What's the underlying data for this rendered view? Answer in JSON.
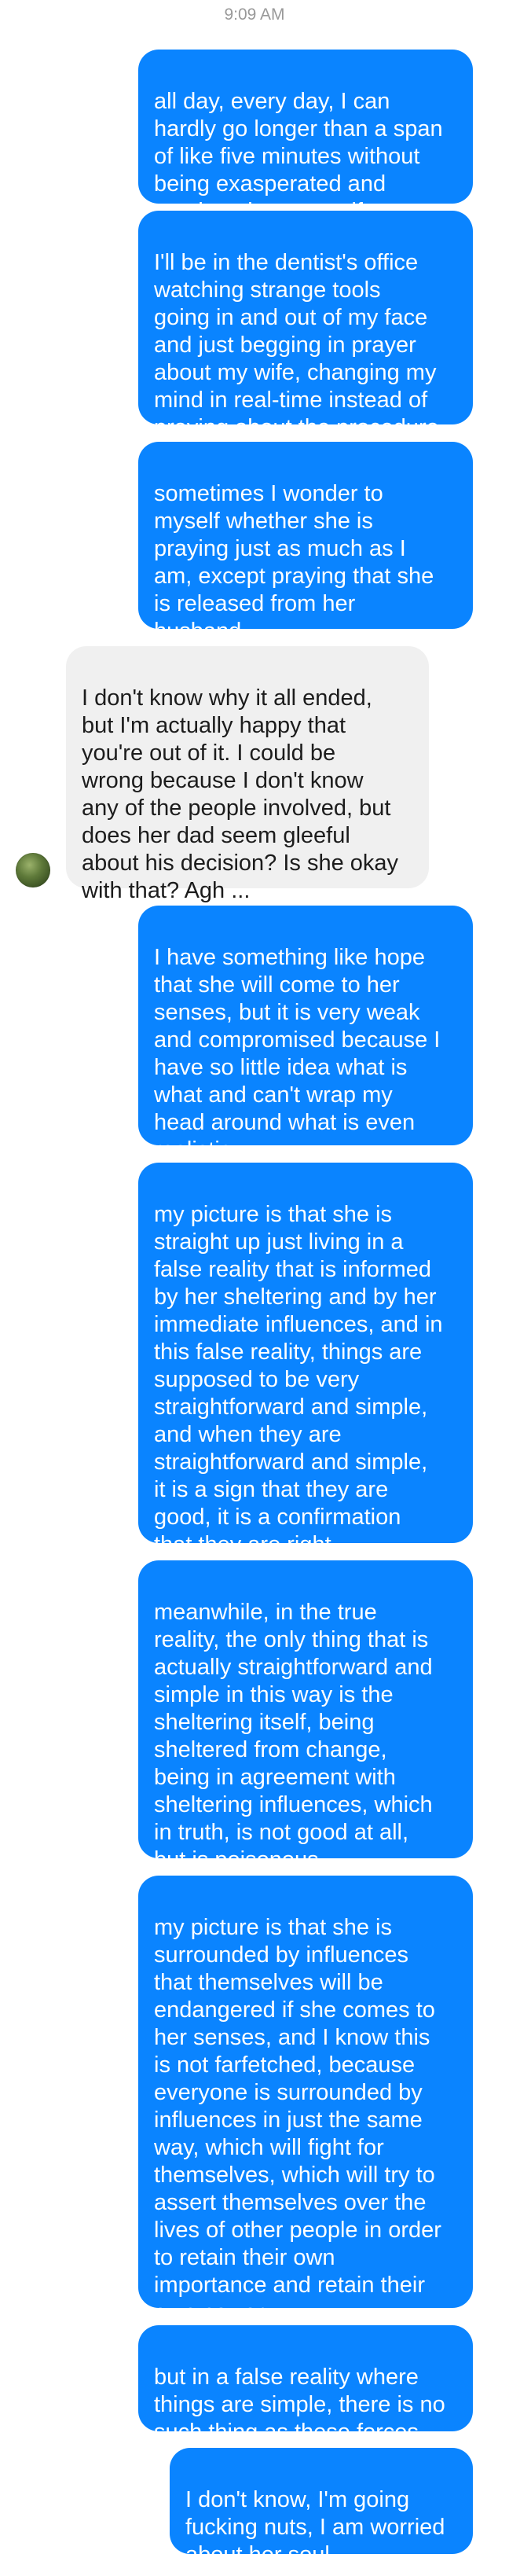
{
  "header": {
    "timestamp": "9:09 AM"
  },
  "contact": {
    "avatar_icon": "profile-photo-icon"
  },
  "messages": [
    {
      "sender": "me",
      "text": "all day, every day, I can\nhardly go longer than a span\nof like five minutes without\nbeing exasperated and\npraying about my wife"
    },
    {
      "sender": "me",
      "text": "I'll be in the dentist's office\nwatching strange tools\ngoing in and out of my face\nand just begging in prayer\nabout my wife, changing my\nmind in real-time instead of\npraying about the procedure"
    },
    {
      "sender": "me",
      "text": "sometimes I wonder to\nmyself whether she is\npraying just as much as I\nam, except praying that she\nis released from her\nhusband"
    },
    {
      "sender": "them",
      "text": "I don't know why it all ended,\nbut I'm actually happy that\nyou're out of it. I could be\nwrong because I don't know\nany of the people involved, but\ndoes her dad seem gleeful\nabout his decision? Is she okay\nwith that? Agh ..."
    },
    {
      "sender": "me",
      "text": "I have something like hope\nthat she will come to her\nsenses, but it is very weak\nand compromised because I\nhave so little idea what is\nwhat and can't wrap my\nhead around what is even\nrealistic"
    },
    {
      "sender": "me",
      "text": "my picture is that she is\nstraight up just living in a\nfalse reality that is informed\nby her sheltering and by her\nimmediate influences, and in\nthis false reality, things are\nsupposed to be very\nstraightforward and simple,\nand when they are\nstraightforward and simple,\nit is a sign that they are\ngood, it is a confirmation\nthat they are right"
    },
    {
      "sender": "me",
      "text": "meanwhile, in the true\nreality, the only thing that is\nactually straightforward and\nsimple in this way is the\nsheltering itself, being\nsheltered from change,\nbeing in agreement with\nsheltering influences, which\nin truth, is not good at all,\nbut is poisonous"
    },
    {
      "sender": "me",
      "text": "my picture is that she is\nsurrounded by influences\nthat themselves will be\nendangered if she comes to\nher senses, and I know this\nis not farfetched, because\neveryone is surrounded by\ninfluences in just the same\nway, which will fight for\nthemselves, which will try to\nassert themselves over the\nlives of other people in order\nto retain their own\nimportance and retain their\nown power"
    },
    {
      "sender": "me",
      "text": "but in a false reality where\nthings are simple, there is no\nsuch thing as these forces"
    },
    {
      "sender": "me",
      "text": "I don't know, I'm going\nfucking nuts, I am worried\nabout her soul"
    }
  ],
  "colors": {
    "outgoing_bubble": "#0a84ff",
    "incoming_bubble": "#f0f0f0",
    "timestamp": "#999999"
  }
}
